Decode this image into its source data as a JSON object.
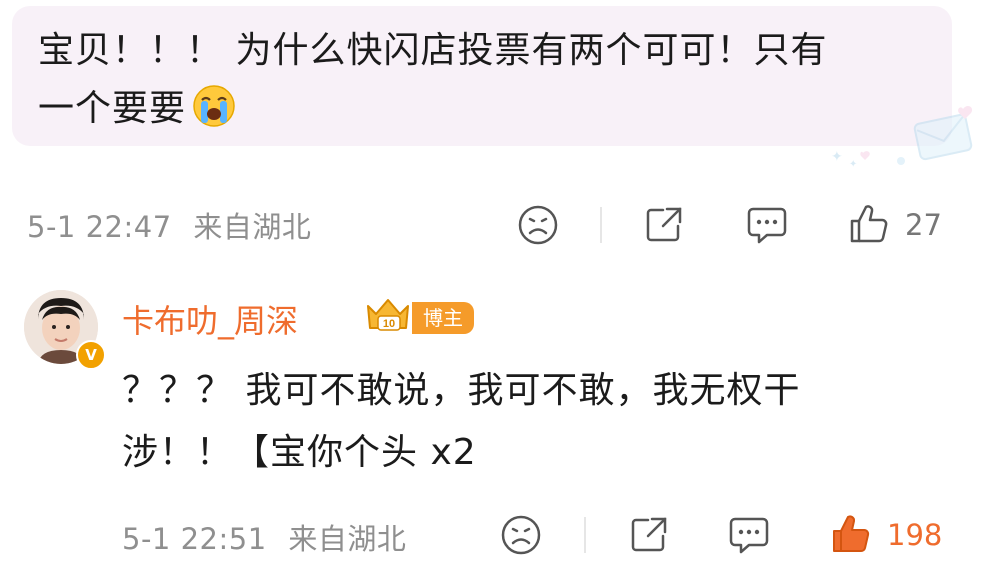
{
  "post": {
    "text_line1": "宝贝！！！ 为什么快闪店投票有两个可可！只有",
    "text_line2": "一个要要",
    "emoji": "loudly-crying-face",
    "timestamp": "5-1 22:47",
    "location": "来自湖北",
    "like_count": "27"
  },
  "reply": {
    "username": "卡布叻_周深",
    "author_tag": "博主",
    "text_line1": "？？？ 我可不敢说，我可不敢，我无权干",
    "text_line2": "涉！！【宝你个头 x2",
    "timestamp": "5-1 22:51",
    "location": "来自湖北",
    "like_count": "198"
  },
  "colors": {
    "bubble_bg": "#f8f1f8",
    "username": "#ef6c2d",
    "like_active": "#ef6c2d",
    "meta_gray": "#8f8f8f",
    "author_tag_bg": "#f59b2a"
  }
}
